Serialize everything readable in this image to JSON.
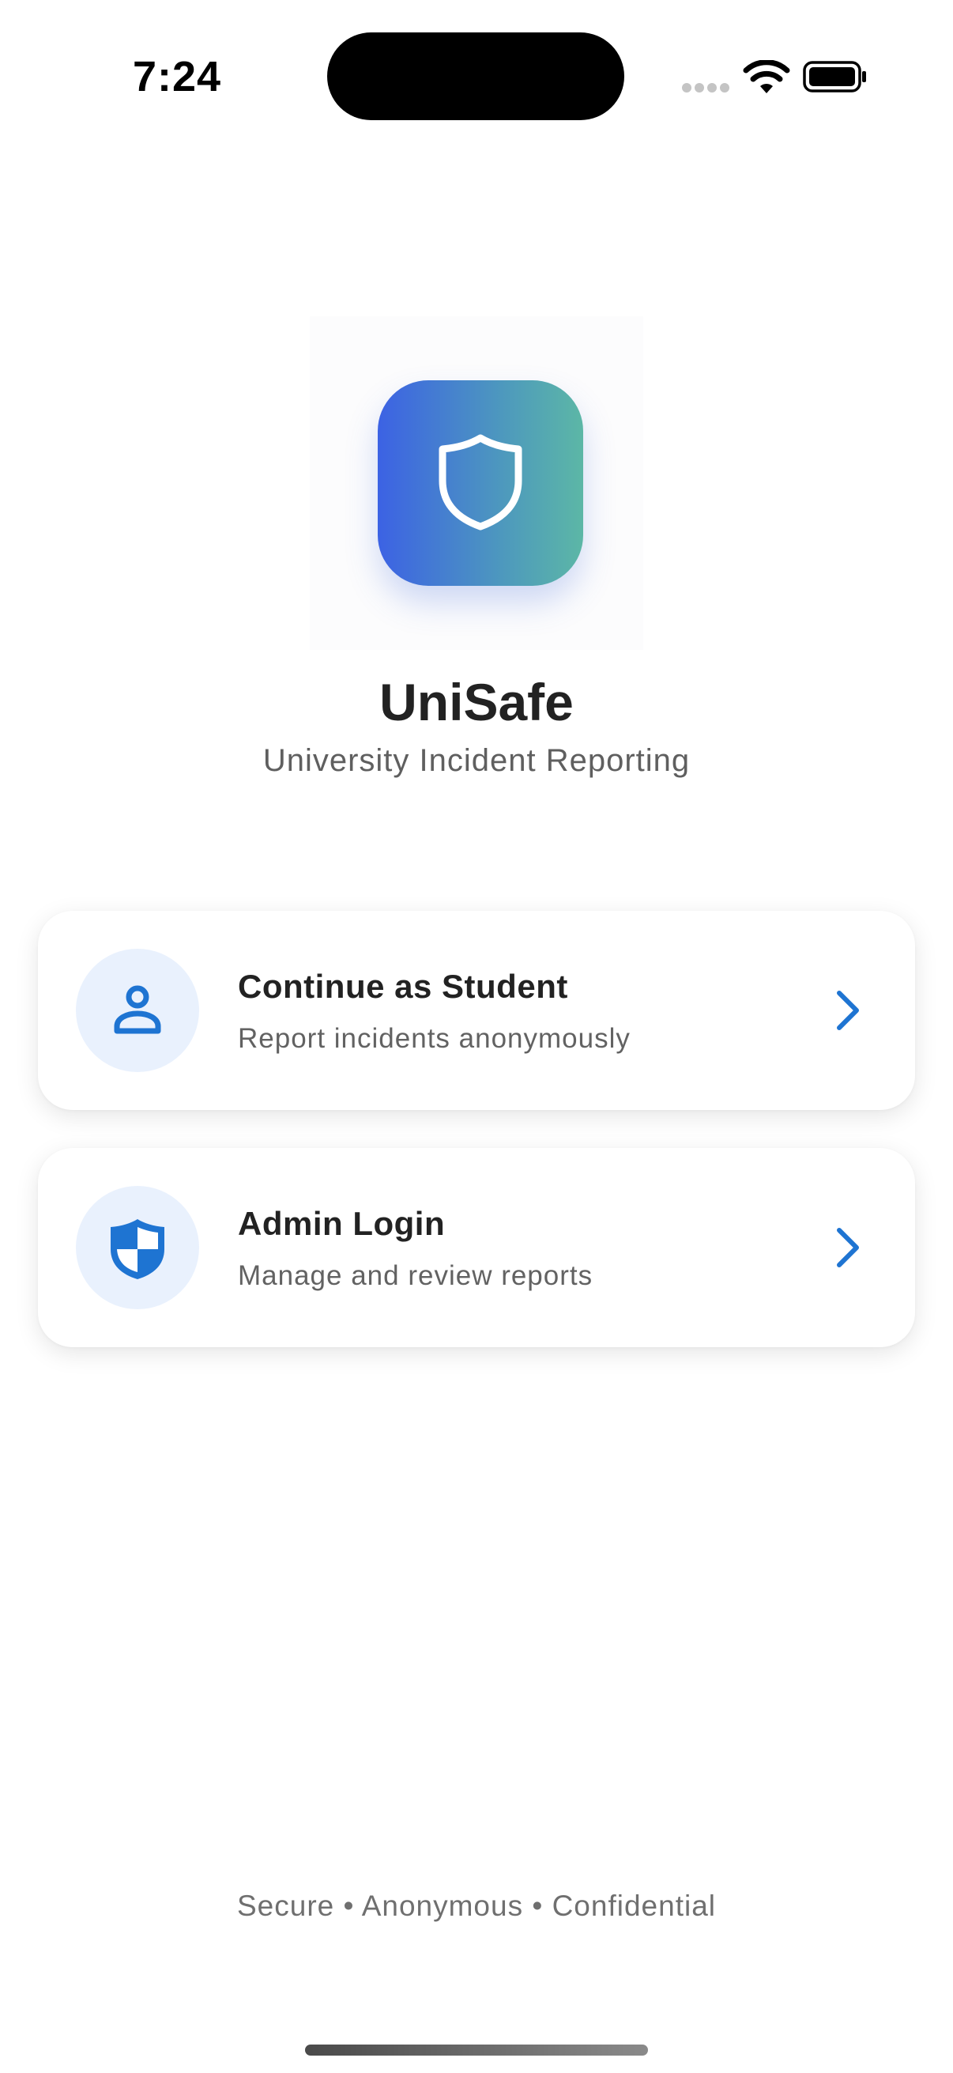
{
  "status_bar": {
    "time": "7:24",
    "icons": [
      "signal-dots-icon",
      "wifi-icon",
      "battery-icon"
    ]
  },
  "app": {
    "logo_icon": "shield-icon",
    "title": "UniSafe",
    "subtitle": "University Incident Reporting"
  },
  "options": [
    {
      "title": "Continue as Student",
      "description": "Report incidents anonymously",
      "icon": "person-icon"
    },
    {
      "title": "Admin Login",
      "description": "Manage and review reports",
      "icon": "admin-shield-icon"
    }
  ],
  "footer": {
    "text": "Secure • Anonymous • Confidential"
  },
  "colors": {
    "accent": "#1e74d2",
    "icon_circle_bg": "#e9f1fd",
    "gradient_start": "#3c62e4",
    "gradient_end": "#5cb7a6"
  }
}
